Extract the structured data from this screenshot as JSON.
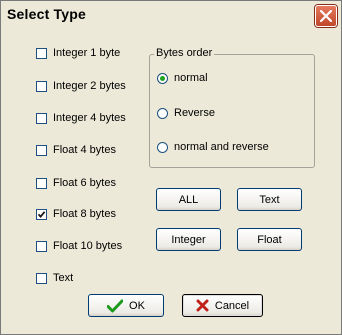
{
  "window": {
    "title": "Select Type",
    "close_icon": "close-icon"
  },
  "checkboxes": [
    {
      "label": "Integer 1 byte",
      "checked": false
    },
    {
      "label": "Integer 2 bytes",
      "checked": false
    },
    {
      "label": "Integer 4 bytes",
      "checked": false
    },
    {
      "label": "Float 4 bytes",
      "checked": false
    },
    {
      "label": "Float 6 bytes",
      "checked": false
    },
    {
      "label": "Float 8 bytes",
      "checked": true
    },
    {
      "label": "Float 10 bytes",
      "checked": false
    },
    {
      "label": "Text",
      "checked": false
    }
  ],
  "bytes_order": {
    "label": "Bytes order",
    "options": [
      {
        "label": "normal",
        "selected": true
      },
      {
        "label": "Reverse",
        "selected": false
      },
      {
        "label": "normal and reverse",
        "selected": false
      }
    ]
  },
  "buttons": {
    "all": "ALL",
    "text": "Text",
    "integer": "Integer",
    "float": "Float",
    "ok": "OK",
    "cancel": "Cancel"
  },
  "colors": {
    "ok_check": "#1e9a1e",
    "cancel_x": "#c0221a",
    "radio_dot": "#21a121",
    "close_button": "#d4573a"
  }
}
